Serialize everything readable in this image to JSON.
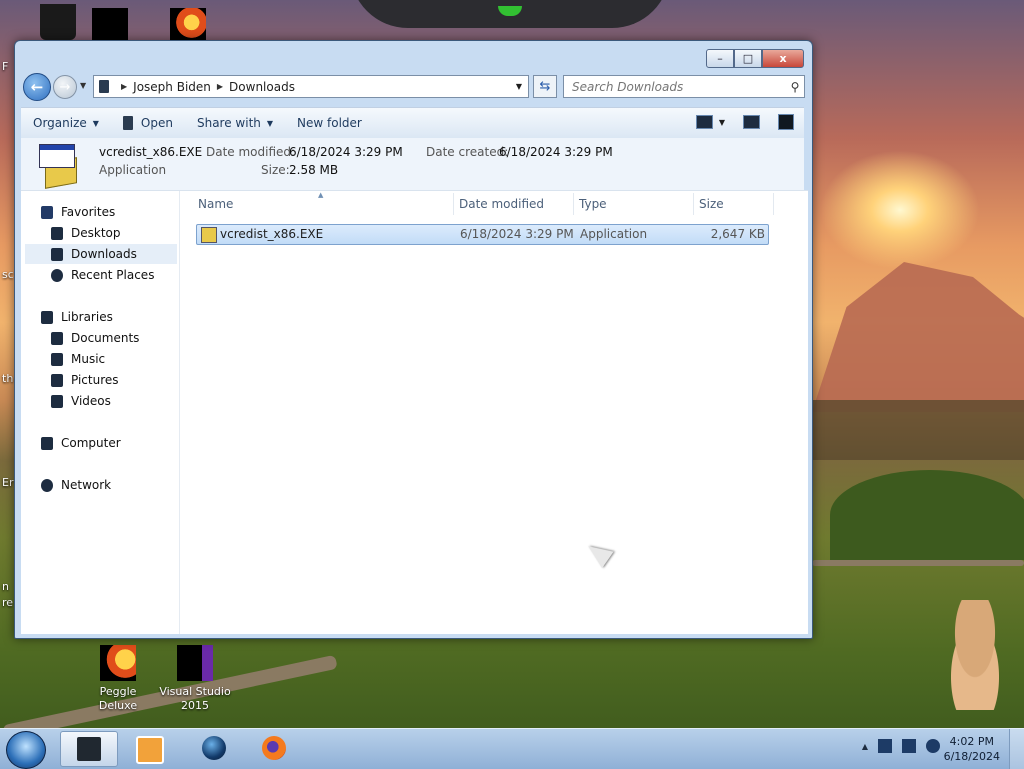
{
  "desktop": {
    "icons": [
      {
        "label": "Peggle Deluxe"
      },
      {
        "label": "Visual Studio 2015"
      }
    ],
    "edge_text": [
      "F",
      "sc",
      "th",
      "Er",
      "n",
      "re"
    ]
  },
  "window": {
    "buttons": {
      "minimize": "–",
      "maximize": "□",
      "close": "x"
    },
    "address": {
      "crumbs": [
        "Joseph Biden",
        "Downloads"
      ]
    },
    "search": {
      "placeholder": "Search Downloads"
    },
    "toolbar": {
      "organize": "Organize",
      "open": "Open",
      "share_with": "Share with",
      "new_folder": "New folder"
    },
    "details": {
      "file_name": "vcredist_x86.EXE",
      "file_type": "Application",
      "date_modified_label": "Date modified:",
      "date_modified_value": "6/18/2024 3:29 PM",
      "size_label": "Size:",
      "size_value": "2.58 MB",
      "date_created_label": "Date created:",
      "date_created_value": "6/18/2024 3:29 PM"
    },
    "nav": {
      "favorites": "Favorites",
      "desktop": "Desktop",
      "downloads": "Downloads",
      "recent_places": "Recent Places",
      "libraries": "Libraries",
      "documents": "Documents",
      "music": "Music",
      "pictures": "Pictures",
      "videos": "Videos",
      "computer": "Computer",
      "network": "Network"
    },
    "columns": {
      "name": "Name",
      "date_modified": "Date modified",
      "type": "Type",
      "size": "Size"
    },
    "files": [
      {
        "name": "vcredist_x86.EXE",
        "date_modified": "6/18/2024 3:29 PM",
        "type": "Application",
        "size": "2,647 KB"
      }
    ]
  },
  "taskbar": {
    "clock": {
      "time": "4:02 PM",
      "date": "6/18/2024"
    }
  },
  "colors": {
    "selection": "#c2dcf7",
    "toolbar": "#dbe7f4",
    "taskbar": "#8fb0d6"
  }
}
